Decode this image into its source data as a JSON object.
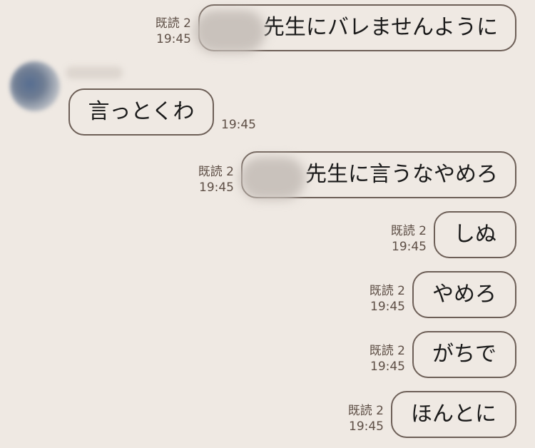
{
  "messages": [
    {
      "text": "先生にバレませんように",
      "read": "既読 2",
      "time": "19:45"
    },
    {
      "text": "言っとくわ",
      "time": "19:45"
    },
    {
      "text": "先生に言うなやめろ",
      "read": "既読 2",
      "time": "19:45"
    },
    {
      "text": "しぬ",
      "read": "既読 2",
      "time": "19:45"
    },
    {
      "text": "やめろ",
      "read": "既読 2",
      "time": "19:45"
    },
    {
      "text": "がちで",
      "read": "既読 2",
      "time": "19:45"
    },
    {
      "text": "ほんとに",
      "read": "既読 2",
      "time": "19:45"
    }
  ]
}
